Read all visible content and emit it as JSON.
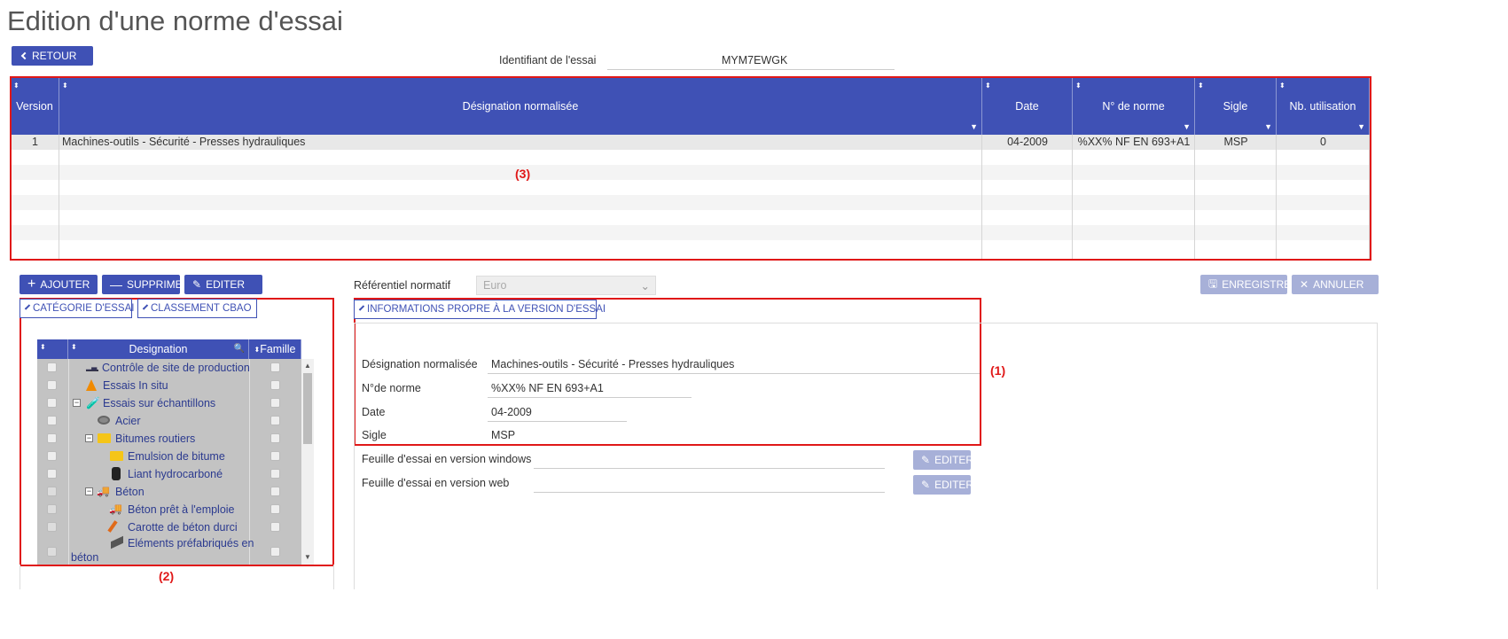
{
  "page_title": "Edition d'une norme d'essai",
  "retour_label": "RETOUR",
  "identifiant": {
    "label": "Identifiant de l'essai",
    "value": "MYM7EWGK"
  },
  "main_grid": {
    "headers": {
      "version": "Version",
      "designation": "Désignation normalisée",
      "date": "Date",
      "norme": "N° de norme",
      "sigle": "Sigle",
      "nb": "Nb. utilisation"
    },
    "row1": {
      "version": "1",
      "designation": "Machines-outils - Sécurité - Presses hydrauliques",
      "date": "04-2009",
      "norme": "%XX% NF EN 693+A1",
      "sigle": "MSP",
      "nb": "0"
    }
  },
  "annotations": {
    "a1": "(1)",
    "a2": "(2)",
    "a3": "(3)"
  },
  "toolbar": {
    "ajouter": "AJOUTER",
    "supprimer": "SUPPRIMER",
    "editer": "EDITER",
    "enregistrer": "ENREGISTRER",
    "annuler": "ANNULER"
  },
  "tabs": {
    "categorie": "CATÉGORIE D'ESSAI",
    "classement": "CLASSEMENT CBAO",
    "informations": "INFORMATIONS PROPRE À LA VERSION D'ESSAI"
  },
  "referentiel": {
    "label": "Référentiel normatif",
    "value": "Euro"
  },
  "tree": {
    "headers": {
      "designation": "Designation",
      "famille": "Famille"
    },
    "items": [
      {
        "label": "Contrôle de site de production",
        "icon": "gauge-icon"
      },
      {
        "label": "Essais In situ",
        "icon": "cone-icon"
      },
      {
        "label": "Essais sur échantillons",
        "icon": "pipette-icon"
      },
      {
        "label": "Acier",
        "icon": "steel-icon"
      },
      {
        "label": "Bitumes routiers",
        "icon": "folder-icon"
      },
      {
        "label": "Emulsion de bitume",
        "icon": "folder-icon"
      },
      {
        "label": "Liant hydrocarboné",
        "icon": "barrel-icon"
      },
      {
        "label": "Béton",
        "icon": "truck-icon"
      },
      {
        "label": "Béton prêt à l'emploie",
        "icon": "truck-icon"
      },
      {
        "label": "Carotte de béton durci",
        "icon": "carrot-icon"
      },
      {
        "label": "Eléments préfabriqués en",
        "label2": "béton",
        "icon": "slab-icon"
      }
    ]
  },
  "form": {
    "designation": {
      "label": "Désignation normalisée",
      "value": "Machines-outils - Sécurité - Presses hydrauliques"
    },
    "norme": {
      "label": "N°de norme",
      "value": "%XX% NF EN 693+A1"
    },
    "date": {
      "label": "Date",
      "value": "04-2009"
    },
    "sigle": {
      "label": "Sigle",
      "value": "MSP"
    },
    "feuille_windows": {
      "label": "Feuille d'essai en version windows",
      "value": "",
      "button": "EDITER"
    },
    "feuille_web": {
      "label": "Feuille d'essai en version web",
      "value": "",
      "button": "EDITER"
    }
  },
  "colors": {
    "primary": "#3f51b5",
    "annotation_red": "#e01818"
  }
}
